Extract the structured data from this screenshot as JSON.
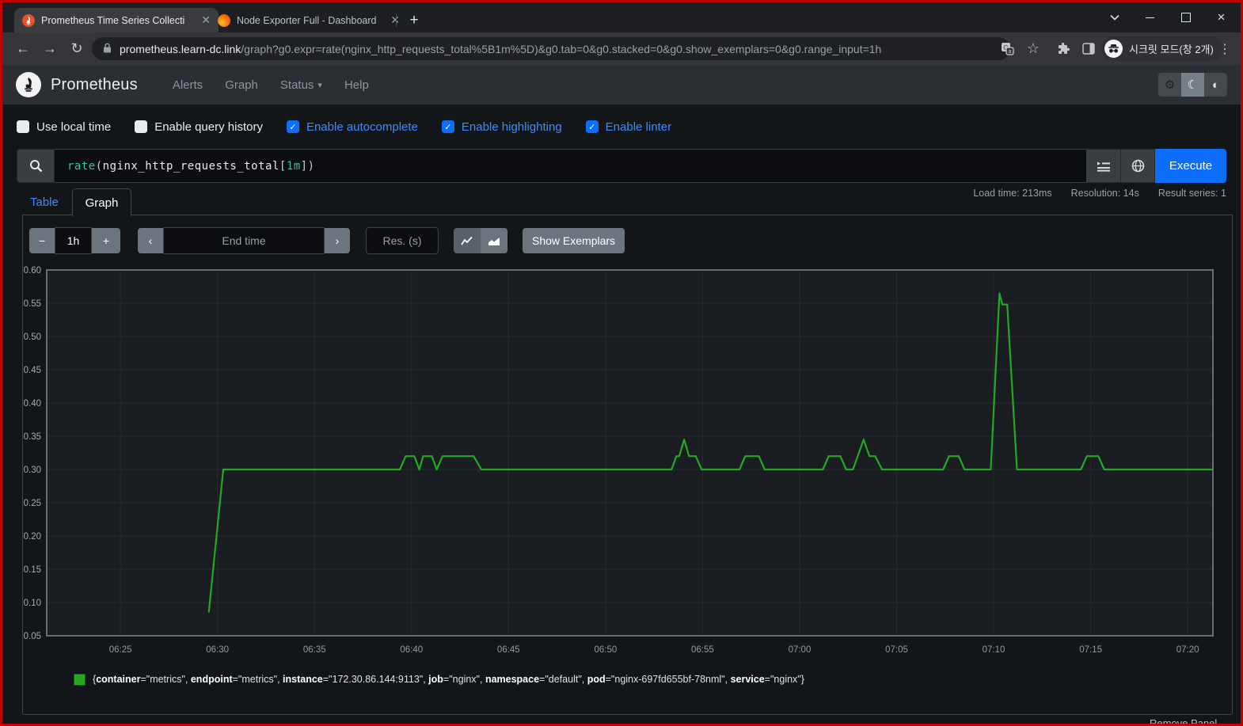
{
  "browser": {
    "tabs": [
      {
        "title": "Prometheus Time Series Collecti"
      },
      {
        "title": "Node Exporter Full - Dashboard"
      }
    ],
    "url_domain": "prometheus.learn-dc.link",
    "url_path": "/graph?g0.expr=rate(nginx_http_requests_total%5B1m%5D)&g0.tab=0&g0.stacked=0&g0.show_exemplars=0&g0.range_input=1h",
    "incognito_label": "시크릿 모드(창 2개)"
  },
  "navbar": {
    "brand": "Prometheus",
    "links": [
      {
        "label": "Alerts",
        "dropdown": false
      },
      {
        "label": "Graph",
        "dropdown": false
      },
      {
        "label": "Status",
        "dropdown": true
      },
      {
        "label": "Help",
        "dropdown": false
      }
    ]
  },
  "options": [
    {
      "label": "Use local time",
      "checked": false
    },
    {
      "label": "Enable query history",
      "checked": false
    },
    {
      "label": "Enable autocomplete",
      "checked": true
    },
    {
      "label": "Enable highlighting",
      "checked": true
    },
    {
      "label": "Enable linter",
      "checked": true
    }
  ],
  "query": {
    "expression_parts": [
      {
        "text": "rate",
        "type": "function"
      },
      {
        "text": "(",
        "type": "paren"
      },
      {
        "text": "nginx_http_requests_total",
        "type": "metric"
      },
      {
        "text": "[",
        "type": "paren"
      },
      {
        "text": "1m",
        "type": "duration"
      },
      {
        "text": "]",
        "type": "paren"
      },
      {
        "text": ")",
        "type": "paren"
      }
    ],
    "execute_label": "Execute"
  },
  "stats": {
    "load_time": "Load time: 213ms",
    "resolution": "Resolution: 14s",
    "result_series": "Result series: 1"
  },
  "result_tabs": {
    "table": "Table",
    "graph": "Graph"
  },
  "graph_controls": {
    "duration_value": "1h",
    "end_time_placeholder": "End time",
    "resolution_placeholder": "Res. (s)",
    "show_exemplars_label": "Show Exemplars"
  },
  "chart_data": {
    "type": "line",
    "title": "rate(nginx_http_requests_total[1m])",
    "grid": true,
    "legend_position": "bottom",
    "x_range_minutes": [
      21.2,
      81.3
    ],
    "y_range": [
      0.05,
      0.6
    ],
    "x_ticks": [
      {
        "m": 25,
        "label": "06:25"
      },
      {
        "m": 30,
        "label": "06:30"
      },
      {
        "m": 35,
        "label": "06:35"
      },
      {
        "m": 40,
        "label": "06:40"
      },
      {
        "m": 45,
        "label": "06:45"
      },
      {
        "m": 50,
        "label": "06:50"
      },
      {
        "m": 55,
        "label": "06:55"
      },
      {
        "m": 60,
        "label": "07:00"
      },
      {
        "m": 65,
        "label": "07:05"
      },
      {
        "m": 70,
        "label": "07:10"
      },
      {
        "m": 75,
        "label": "07:15"
      },
      {
        "m": 80,
        "label": "07:20"
      }
    ],
    "y_ticks": [
      "0.60",
      "0.55",
      "0.50",
      "0.45",
      "0.40",
      "0.35",
      "0.30",
      "0.25",
      "0.20",
      "0.15",
      "0.10",
      "0.05"
    ],
    "series": [
      {
        "name": "rate(nginx_http_requests_total[1m])",
        "color": "#24a924",
        "points_minutes_value": [
          [
            29.55,
            0.085
          ],
          [
            30.3,
            0.3
          ],
          [
            39.4,
            0.3
          ],
          [
            39.7,
            0.32
          ],
          [
            40.15,
            0.32
          ],
          [
            40.4,
            0.3
          ],
          [
            40.6,
            0.32
          ],
          [
            41.05,
            0.32
          ],
          [
            41.3,
            0.3
          ],
          [
            41.6,
            0.32
          ],
          [
            43.2,
            0.32
          ],
          [
            43.6,
            0.3
          ],
          [
            53.4,
            0.3
          ],
          [
            53.65,
            0.32
          ],
          [
            53.8,
            0.32
          ],
          [
            54.05,
            0.345
          ],
          [
            54.3,
            0.32
          ],
          [
            54.65,
            0.32
          ],
          [
            54.95,
            0.3
          ],
          [
            56.9,
            0.3
          ],
          [
            57.2,
            0.32
          ],
          [
            57.9,
            0.32
          ],
          [
            58.2,
            0.3
          ],
          [
            61.2,
            0.3
          ],
          [
            61.5,
            0.32
          ],
          [
            62.1,
            0.32
          ],
          [
            62.4,
            0.3
          ],
          [
            62.75,
            0.3
          ],
          [
            63.3,
            0.345
          ],
          [
            63.6,
            0.32
          ],
          [
            63.9,
            0.32
          ],
          [
            64.25,
            0.3
          ],
          [
            67.4,
            0.3
          ],
          [
            67.7,
            0.32
          ],
          [
            68.2,
            0.32
          ],
          [
            68.5,
            0.3
          ],
          [
            69.85,
            0.3
          ],
          [
            70.3,
            0.565
          ],
          [
            70.45,
            0.548
          ],
          [
            70.7,
            0.548
          ],
          [
            71.2,
            0.3
          ],
          [
            74.5,
            0.3
          ],
          [
            74.8,
            0.32
          ],
          [
            75.4,
            0.32
          ],
          [
            75.7,
            0.3
          ],
          [
            81.3,
            0.3
          ]
        ]
      }
    ]
  },
  "legend": {
    "labels": [
      {
        "name": "container",
        "value": "metrics"
      },
      {
        "name": "endpoint",
        "value": "metrics"
      },
      {
        "name": "instance",
        "value": "172.30.86.144:9113"
      },
      {
        "name": "job",
        "value": "nginx"
      },
      {
        "name": "namespace",
        "value": "default"
      },
      {
        "name": "pod",
        "value": "nginx-697fd655bf-78nml"
      },
      {
        "name": "service",
        "value": "nginx"
      }
    ]
  },
  "panel_footer": {
    "remove_panel_label": "Remove Panel"
  },
  "colors": {
    "accent_blue": "#0d6efd",
    "link_blue": "#3d8bfd",
    "series_green": "#24a924",
    "frame_red": "#c20000"
  }
}
